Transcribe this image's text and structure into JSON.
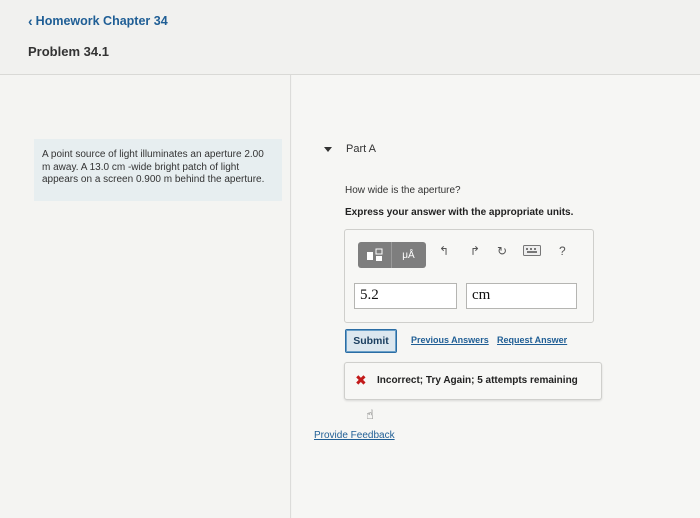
{
  "header": {
    "back_label": "Homework Chapter 34",
    "problem_title": "Problem 34.1"
  },
  "question": {
    "text_line1": "A point source of light illuminates an aperture 2.00",
    "text_line2": "m away. A 13.0 cm -wide bright patch of light",
    "text_line3": "appears on a screen 0.900 m behind the aperture."
  },
  "part": {
    "label": "Part A",
    "prompt": "How wide is the aperture?",
    "instruction": "Express your answer with the appropriate units."
  },
  "toolbar": {
    "templates_icon": "templates-icon",
    "units_label": "μÅ",
    "undo_icon": "undo-icon",
    "redo_icon": "redo-icon",
    "reset_icon": "reset-icon",
    "keyboard_icon": "keyboard-icon",
    "help_label": "?"
  },
  "answer": {
    "value": "5.2",
    "units": "cm"
  },
  "actions": {
    "submit_label": "Submit",
    "previous_answers": "Previous Answers",
    "request_answer": "Request Answer"
  },
  "feedback": {
    "mark": "✖",
    "message": "Incorrect; Try Again; 5 attempts remaining"
  },
  "footer": {
    "provide_feedback": "Provide Feedback"
  },
  "colors": {
    "link": "#1f5e95",
    "error": "#c21a1a",
    "toolbar": "#7e7e7e"
  }
}
